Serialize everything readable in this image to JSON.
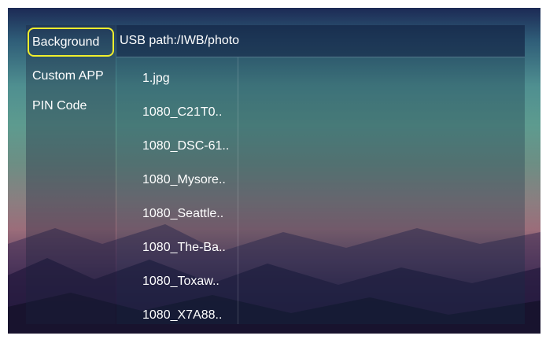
{
  "sidebar": {
    "items": [
      {
        "label": "Background",
        "selected": true
      },
      {
        "label": "Custom APP",
        "selected": false
      },
      {
        "label": "PIN Code",
        "selected": false
      }
    ]
  },
  "content": {
    "path": "USB path:/IWB/photo",
    "files": [
      "1.jpg",
      "1080_C21T0..",
      "1080_DSC-61..",
      "1080_Mysore..",
      "1080_Seattle..",
      "1080_The-Ba..",
      "1080_Toxaw..",
      "1080_X7A88.."
    ]
  },
  "colors": {
    "focus_outline": "#f2ef2c",
    "text": "#ffffff"
  }
}
